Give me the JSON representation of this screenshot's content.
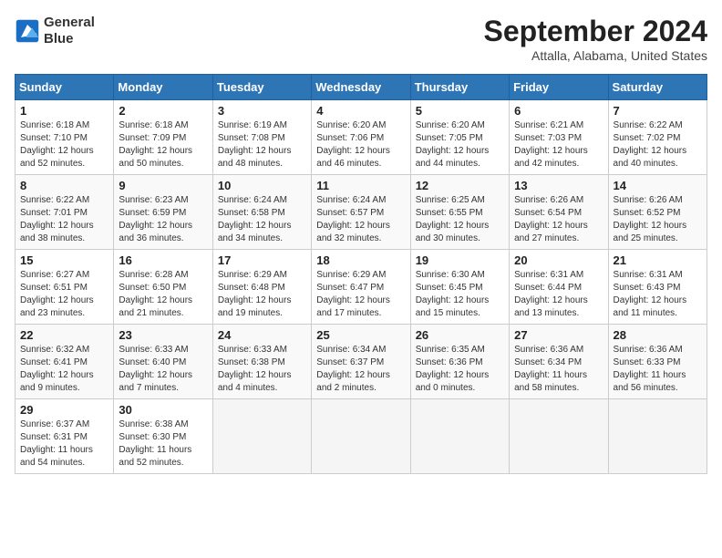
{
  "header": {
    "logo_line1": "General",
    "logo_line2": "Blue",
    "title": "September 2024",
    "subtitle": "Attalla, Alabama, United States"
  },
  "columns": [
    "Sunday",
    "Monday",
    "Tuesday",
    "Wednesday",
    "Thursday",
    "Friday",
    "Saturday"
  ],
  "weeks": [
    [
      {
        "day": 1,
        "rise": "6:18 AM",
        "set": "7:10 PM",
        "hours": "12 hours",
        "mins": "52 minutes."
      },
      {
        "day": 2,
        "rise": "6:18 AM",
        "set": "7:09 PM",
        "hours": "12 hours",
        "mins": "50 minutes."
      },
      {
        "day": 3,
        "rise": "6:19 AM",
        "set": "7:08 PM",
        "hours": "12 hours",
        "mins": "48 minutes."
      },
      {
        "day": 4,
        "rise": "6:20 AM",
        "set": "7:06 PM",
        "hours": "12 hours",
        "mins": "46 minutes."
      },
      {
        "day": 5,
        "rise": "6:20 AM",
        "set": "7:05 PM",
        "hours": "12 hours",
        "mins": "44 minutes."
      },
      {
        "day": 6,
        "rise": "6:21 AM",
        "set": "7:03 PM",
        "hours": "12 hours",
        "mins": "42 minutes."
      },
      {
        "day": 7,
        "rise": "6:22 AM",
        "set": "7:02 PM",
        "hours": "12 hours",
        "mins": "40 minutes."
      }
    ],
    [
      {
        "day": 8,
        "rise": "6:22 AM",
        "set": "7:01 PM",
        "hours": "12 hours",
        "mins": "38 minutes."
      },
      {
        "day": 9,
        "rise": "6:23 AM",
        "set": "6:59 PM",
        "hours": "12 hours",
        "mins": "36 minutes."
      },
      {
        "day": 10,
        "rise": "6:24 AM",
        "set": "6:58 PM",
        "hours": "12 hours",
        "mins": "34 minutes."
      },
      {
        "day": 11,
        "rise": "6:24 AM",
        "set": "6:57 PM",
        "hours": "12 hours",
        "mins": "32 minutes."
      },
      {
        "day": 12,
        "rise": "6:25 AM",
        "set": "6:55 PM",
        "hours": "12 hours",
        "mins": "30 minutes."
      },
      {
        "day": 13,
        "rise": "6:26 AM",
        "set": "6:54 PM",
        "hours": "12 hours",
        "mins": "27 minutes."
      },
      {
        "day": 14,
        "rise": "6:26 AM",
        "set": "6:52 PM",
        "hours": "12 hours",
        "mins": "25 minutes."
      }
    ],
    [
      {
        "day": 15,
        "rise": "6:27 AM",
        "set": "6:51 PM",
        "hours": "12 hours",
        "mins": "23 minutes."
      },
      {
        "day": 16,
        "rise": "6:28 AM",
        "set": "6:50 PM",
        "hours": "12 hours",
        "mins": "21 minutes."
      },
      {
        "day": 17,
        "rise": "6:29 AM",
        "set": "6:48 PM",
        "hours": "12 hours",
        "mins": "19 minutes."
      },
      {
        "day": 18,
        "rise": "6:29 AM",
        "set": "6:47 PM",
        "hours": "12 hours",
        "mins": "17 minutes."
      },
      {
        "day": 19,
        "rise": "6:30 AM",
        "set": "6:45 PM",
        "hours": "12 hours",
        "mins": "15 minutes."
      },
      {
        "day": 20,
        "rise": "6:31 AM",
        "set": "6:44 PM",
        "hours": "12 hours",
        "mins": "13 minutes."
      },
      {
        "day": 21,
        "rise": "6:31 AM",
        "set": "6:43 PM",
        "hours": "12 hours",
        "mins": "11 minutes."
      }
    ],
    [
      {
        "day": 22,
        "rise": "6:32 AM",
        "set": "6:41 PM",
        "hours": "12 hours",
        "mins": "9 minutes."
      },
      {
        "day": 23,
        "rise": "6:33 AM",
        "set": "6:40 PM",
        "hours": "12 hours",
        "mins": "7 minutes."
      },
      {
        "day": 24,
        "rise": "6:33 AM",
        "set": "6:38 PM",
        "hours": "12 hours",
        "mins": "4 minutes."
      },
      {
        "day": 25,
        "rise": "6:34 AM",
        "set": "6:37 PM",
        "hours": "12 hours",
        "mins": "2 minutes."
      },
      {
        "day": 26,
        "rise": "6:35 AM",
        "set": "6:36 PM",
        "hours": "12 hours",
        "mins": "0 minutes."
      },
      {
        "day": 27,
        "rise": "6:36 AM",
        "set": "6:34 PM",
        "hours": "11 hours",
        "mins": "58 minutes."
      },
      {
        "day": 28,
        "rise": "6:36 AM",
        "set": "6:33 PM",
        "hours": "11 hours",
        "mins": "56 minutes."
      }
    ],
    [
      {
        "day": 29,
        "rise": "6:37 AM",
        "set": "6:31 PM",
        "hours": "11 hours",
        "mins": "54 minutes."
      },
      {
        "day": 30,
        "rise": "6:38 AM",
        "set": "6:30 PM",
        "hours": "11 hours",
        "mins": "52 minutes."
      },
      null,
      null,
      null,
      null,
      null
    ]
  ]
}
